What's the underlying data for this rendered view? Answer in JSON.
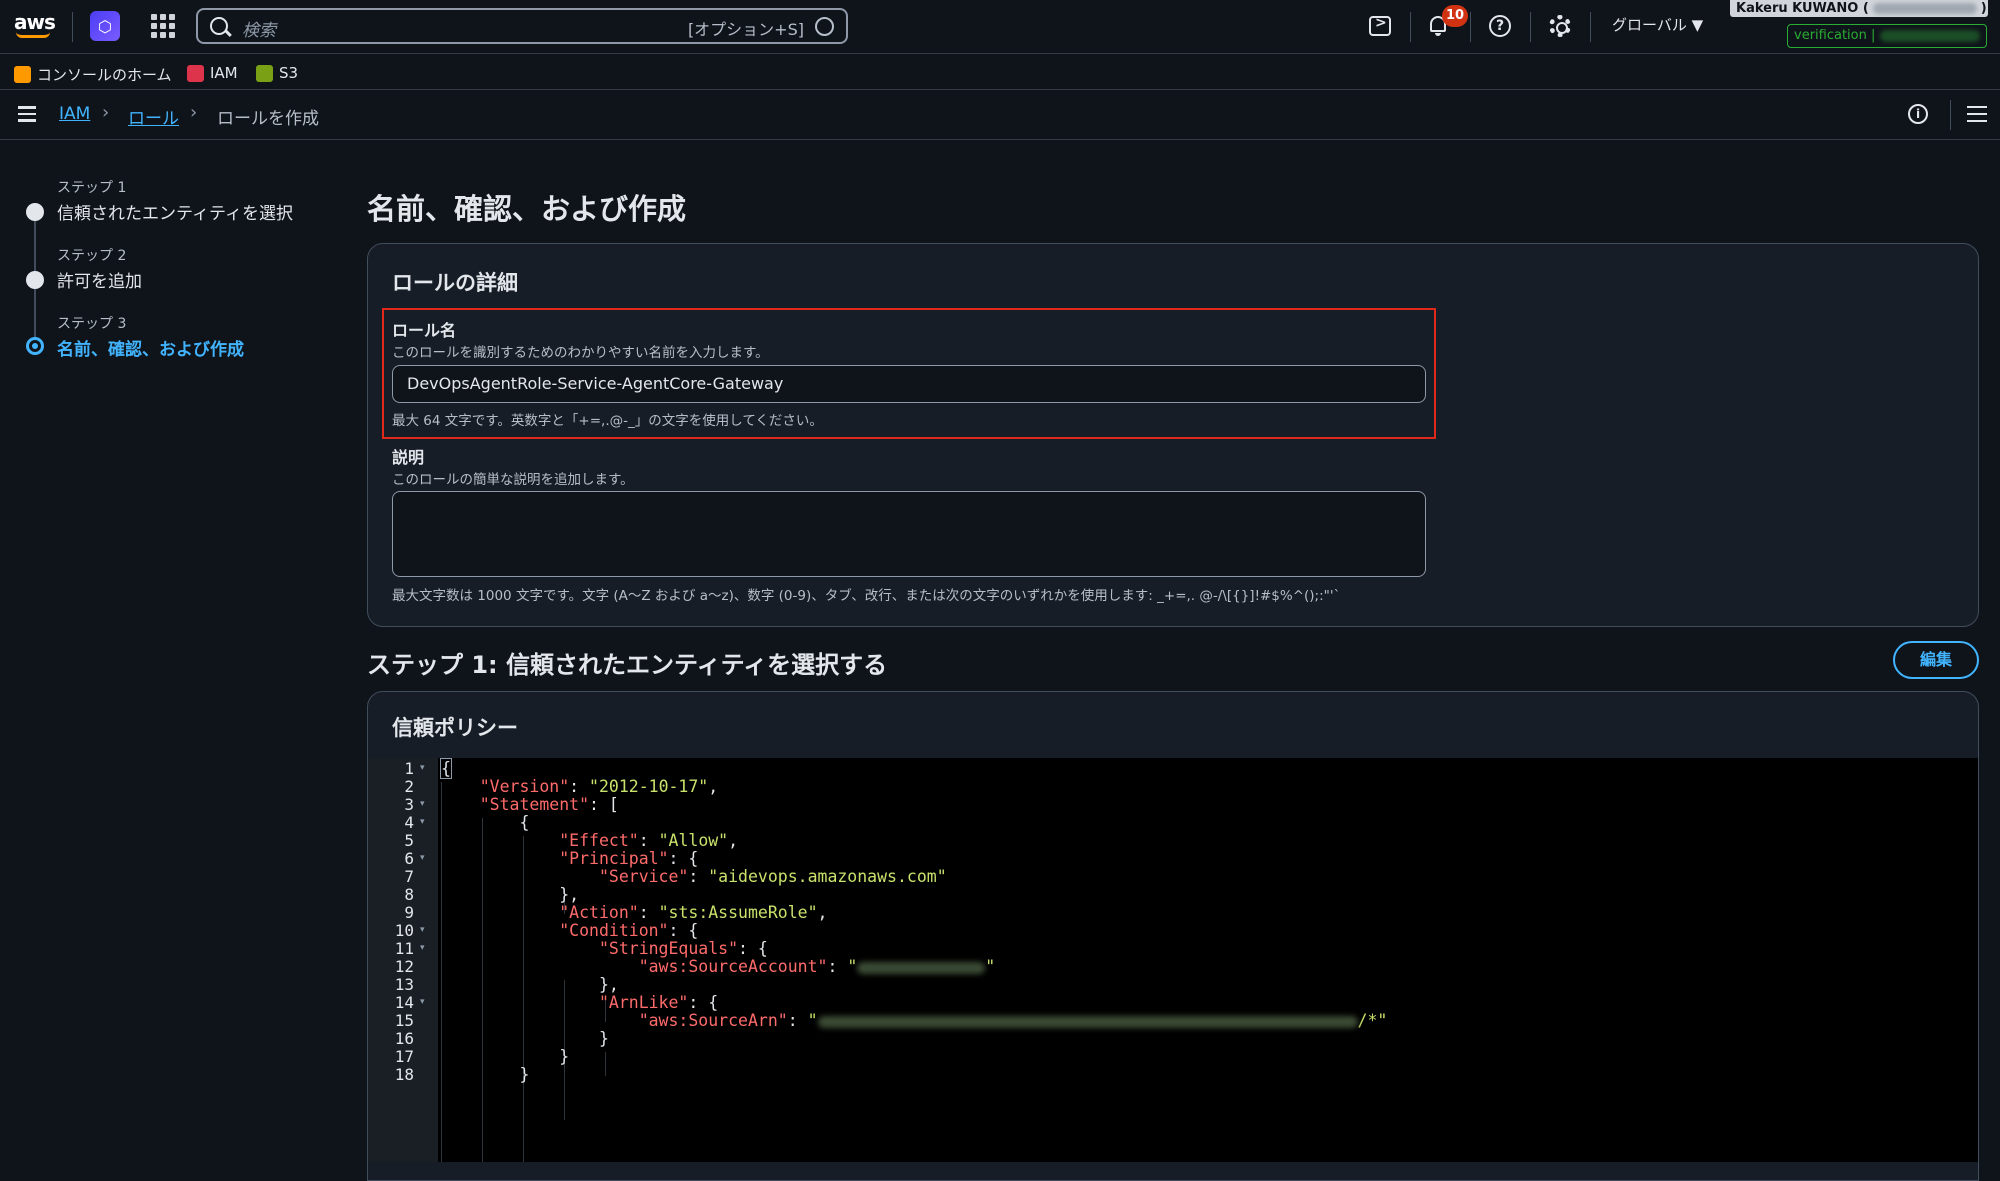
{
  "topbar": {
    "logo_text": "aws",
    "search_placeholder": "検索",
    "search_shortcut": "[オプション+S]",
    "notifications_count": "10",
    "help_glyph": "?",
    "region_label": "グローバル ▼",
    "account_name": "Kakeru KUWANO (",
    "account_suffix": ") ▼",
    "verification_label": "verification |"
  },
  "favorites": [
    {
      "label": "コンソールのホーム",
      "color": "#ff9900"
    },
    {
      "label": "IAM",
      "color": "#dd344c"
    },
    {
      "label": "S3",
      "color": "#7aa116"
    }
  ],
  "breadcrumb": {
    "items": [
      "IAM",
      "ロール"
    ],
    "current": "ロールを作成"
  },
  "steps": [
    {
      "label": "ステップ 1",
      "title": "信頼されたエンティティを選択"
    },
    {
      "label": "ステップ 2",
      "title": "許可を追加"
    },
    {
      "label": "ステップ 3",
      "title": "名前、確認、および作成"
    }
  ],
  "main": {
    "page_title": "名前、確認、および作成",
    "role_details": {
      "title": "ロールの詳細",
      "role_name_label": "ロール名",
      "role_name_desc": "このロールを識別するためのわかりやすい名前を入力します。",
      "role_name_value": "DevOpsAgentRole-Service-AgentCore-Gateway",
      "role_name_constraint": "最大 64 文字です。英数字と「+=,.@-_」の文字を使用してください。",
      "description_label": "説明",
      "description_desc": "このロールの簡単な説明を追加します。",
      "description_value": "",
      "description_constraint": "最大文字数は 1000 文字です。文字 (A〜Z および a〜z)、数字 (0-9)、タブ、改行、または次の文字のいずれかを使用します: _+=,. @-/\\[{}]!#$%^();:\"'`"
    },
    "step1_heading": "ステップ 1: 信頼されたエンティティを選択する",
    "edit_label": "編集",
    "trust_policy_title": "信頼ポリシー"
  },
  "policy_lines": [
    {
      "n": "1",
      "fold": true
    },
    {
      "n": "2",
      "fold": false
    },
    {
      "n": "3",
      "fold": true
    },
    {
      "n": "4",
      "fold": true
    },
    {
      "n": "5",
      "fold": false
    },
    {
      "n": "6",
      "fold": true
    },
    {
      "n": "7",
      "fold": false
    },
    {
      "n": "8",
      "fold": false
    },
    {
      "n": "9",
      "fold": false
    },
    {
      "n": "10",
      "fold": true
    },
    {
      "n": "11",
      "fold": true
    },
    {
      "n": "12",
      "fold": false
    },
    {
      "n": "13",
      "fold": false
    },
    {
      "n": "14",
      "fold": true
    },
    {
      "n": "15",
      "fold": false
    },
    {
      "n": "16",
      "fold": false
    },
    {
      "n": "17",
      "fold": false
    },
    {
      "n": "18",
      "fold": false
    }
  ],
  "policy": {
    "open_brace": "{",
    "version_key": "\"Version\"",
    "version_val": "\"2012-10-17\"",
    "statement_key": "\"Statement\"",
    "effect_key": "\"Effect\"",
    "effect_val": "\"Allow\"",
    "principal_key": "\"Principal\"",
    "service_key": "\"Service\"",
    "service_val": "\"aidevops.amazonaws.com\"",
    "action_key": "\"Action\"",
    "action_val": "\"sts:AssumeRole\"",
    "condition_key": "\"Condition\"",
    "stringequals_key": "\"StringEquals\"",
    "sourceaccount_key": "\"aws:SourceAccount\"",
    "arnlike_key": "\"ArnLike\"",
    "sourcearn_key": "\"aws:SourceArn\"",
    "sourcearn_tail": "/*\""
  }
}
